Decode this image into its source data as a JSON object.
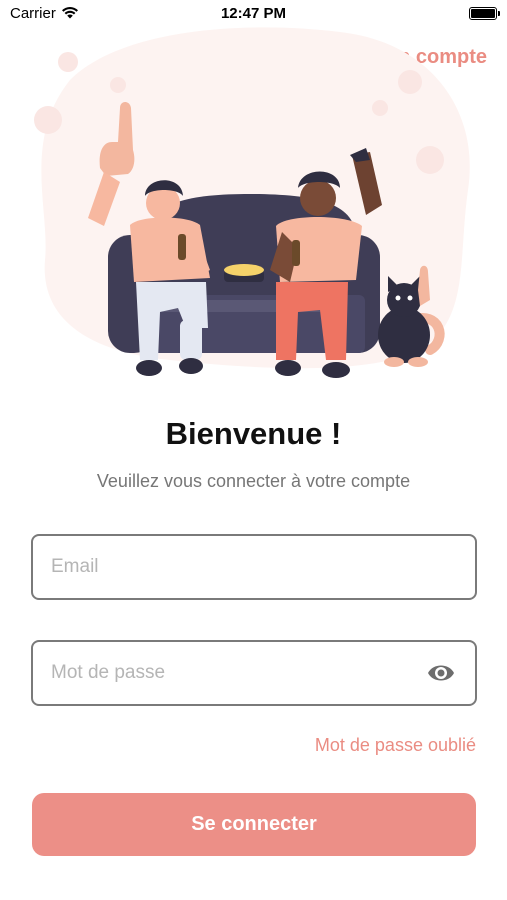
{
  "status_bar": {
    "carrier": "Carrier",
    "time": "12:47 PM"
  },
  "header": {
    "create_account": "Créer un compte"
  },
  "welcome": {
    "title": "Bienvenue !",
    "subtitle": "Veuillez vous connecter à votre compte"
  },
  "form": {
    "email_placeholder": "Email",
    "password_placeholder": "Mot de passe",
    "forgot_password": "Mot de passe oublié",
    "submit": "Se connecter"
  },
  "colors": {
    "accent": "#ea8c82",
    "button": "#ec8f87",
    "sofa": "#3f3d56",
    "blob": "#fdf3f1"
  },
  "icons": {
    "wifi": "wifi-icon",
    "battery": "battery-icon",
    "password_toggle": "eye-icon"
  }
}
